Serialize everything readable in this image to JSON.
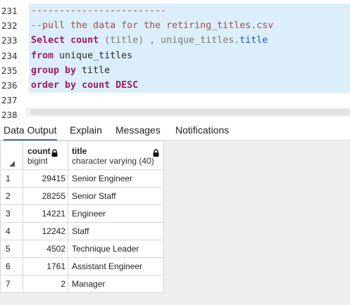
{
  "editor": {
    "line_numbers": [
      "231",
      "232",
      "233",
      "234",
      "235",
      "236",
      "237",
      "238"
    ],
    "lines": {
      "l231": "------------------------",
      "l232": "--pull the data for the retiring_titles.csv",
      "l233_select": "Select",
      "l233_count": "count",
      "l233_mid": " (title) , unique_titles.",
      "l233_title": "title",
      "l234_from": "from",
      "l234_rest": " unique_titles",
      "l235_group": "group by",
      "l235_rest": " title",
      "l236_order": "order by",
      "l236_count": "count",
      "l236_desc": "DESC"
    }
  },
  "tabs": [
    {
      "label": "Data Output",
      "active": true
    },
    {
      "label": "Explain",
      "active": false
    },
    {
      "label": "Messages",
      "active": false
    },
    {
      "label": "Notifications",
      "active": false
    }
  ],
  "grid": {
    "columns": [
      {
        "name": "count",
        "type": "bigint"
      },
      {
        "name": "title",
        "type": "character varying (40)"
      }
    ],
    "rows": [
      {
        "n": "1",
        "count": "29415",
        "title": "Senior Engineer"
      },
      {
        "n": "2",
        "count": "28255",
        "title": "Senior Staff"
      },
      {
        "n": "3",
        "count": "14221",
        "title": "Engineer"
      },
      {
        "n": "4",
        "count": "12242",
        "title": "Staff"
      },
      {
        "n": "5",
        "count": "4502",
        "title": "Technique Leader"
      },
      {
        "n": "6",
        "count": "1761",
        "title": "Assistant Engineer"
      },
      {
        "n": "7",
        "count": "2",
        "title": "Manager"
      }
    ]
  },
  "icons": {
    "column_lock": "lock-icon",
    "sort_corner": "sort-triangle-icon"
  },
  "colors": {
    "selection": "#dbeefa",
    "keyword": "#a01c5e",
    "comment": "#a64d4d",
    "active_tab": "#2f6fd6"
  }
}
